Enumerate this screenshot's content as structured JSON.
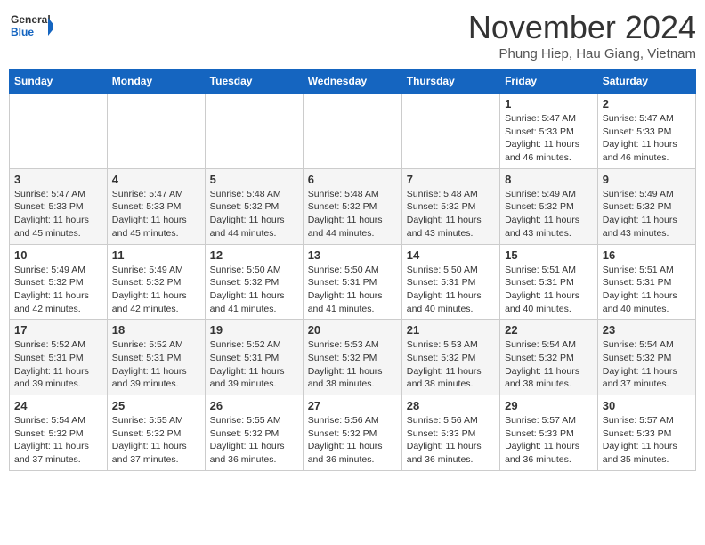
{
  "logo": {
    "general": "General",
    "blue": "Blue"
  },
  "title": "November 2024",
  "location": "Phung Hiep, Hau Giang, Vietnam",
  "headers": [
    "Sunday",
    "Monday",
    "Tuesday",
    "Wednesday",
    "Thursday",
    "Friday",
    "Saturday"
  ],
  "weeks": [
    [
      {
        "day": "",
        "info": ""
      },
      {
        "day": "",
        "info": ""
      },
      {
        "day": "",
        "info": ""
      },
      {
        "day": "",
        "info": ""
      },
      {
        "day": "",
        "info": ""
      },
      {
        "day": "1",
        "info": "Sunrise: 5:47 AM\nSunset: 5:33 PM\nDaylight: 11 hours and 46 minutes."
      },
      {
        "day": "2",
        "info": "Sunrise: 5:47 AM\nSunset: 5:33 PM\nDaylight: 11 hours and 46 minutes."
      }
    ],
    [
      {
        "day": "3",
        "info": "Sunrise: 5:47 AM\nSunset: 5:33 PM\nDaylight: 11 hours and 45 minutes."
      },
      {
        "day": "4",
        "info": "Sunrise: 5:47 AM\nSunset: 5:33 PM\nDaylight: 11 hours and 45 minutes."
      },
      {
        "day": "5",
        "info": "Sunrise: 5:48 AM\nSunset: 5:32 PM\nDaylight: 11 hours and 44 minutes."
      },
      {
        "day": "6",
        "info": "Sunrise: 5:48 AM\nSunset: 5:32 PM\nDaylight: 11 hours and 44 minutes."
      },
      {
        "day": "7",
        "info": "Sunrise: 5:48 AM\nSunset: 5:32 PM\nDaylight: 11 hours and 43 minutes."
      },
      {
        "day": "8",
        "info": "Sunrise: 5:49 AM\nSunset: 5:32 PM\nDaylight: 11 hours and 43 minutes."
      },
      {
        "day": "9",
        "info": "Sunrise: 5:49 AM\nSunset: 5:32 PM\nDaylight: 11 hours and 43 minutes."
      }
    ],
    [
      {
        "day": "10",
        "info": "Sunrise: 5:49 AM\nSunset: 5:32 PM\nDaylight: 11 hours and 42 minutes."
      },
      {
        "day": "11",
        "info": "Sunrise: 5:49 AM\nSunset: 5:32 PM\nDaylight: 11 hours and 42 minutes."
      },
      {
        "day": "12",
        "info": "Sunrise: 5:50 AM\nSunset: 5:32 PM\nDaylight: 11 hours and 41 minutes."
      },
      {
        "day": "13",
        "info": "Sunrise: 5:50 AM\nSunset: 5:31 PM\nDaylight: 11 hours and 41 minutes."
      },
      {
        "day": "14",
        "info": "Sunrise: 5:50 AM\nSunset: 5:31 PM\nDaylight: 11 hours and 40 minutes."
      },
      {
        "day": "15",
        "info": "Sunrise: 5:51 AM\nSunset: 5:31 PM\nDaylight: 11 hours and 40 minutes."
      },
      {
        "day": "16",
        "info": "Sunrise: 5:51 AM\nSunset: 5:31 PM\nDaylight: 11 hours and 40 minutes."
      }
    ],
    [
      {
        "day": "17",
        "info": "Sunrise: 5:52 AM\nSunset: 5:31 PM\nDaylight: 11 hours and 39 minutes."
      },
      {
        "day": "18",
        "info": "Sunrise: 5:52 AM\nSunset: 5:31 PM\nDaylight: 11 hours and 39 minutes."
      },
      {
        "day": "19",
        "info": "Sunrise: 5:52 AM\nSunset: 5:31 PM\nDaylight: 11 hours and 39 minutes."
      },
      {
        "day": "20",
        "info": "Sunrise: 5:53 AM\nSunset: 5:32 PM\nDaylight: 11 hours and 38 minutes."
      },
      {
        "day": "21",
        "info": "Sunrise: 5:53 AM\nSunset: 5:32 PM\nDaylight: 11 hours and 38 minutes."
      },
      {
        "day": "22",
        "info": "Sunrise: 5:54 AM\nSunset: 5:32 PM\nDaylight: 11 hours and 38 minutes."
      },
      {
        "day": "23",
        "info": "Sunrise: 5:54 AM\nSunset: 5:32 PM\nDaylight: 11 hours and 37 minutes."
      }
    ],
    [
      {
        "day": "24",
        "info": "Sunrise: 5:54 AM\nSunset: 5:32 PM\nDaylight: 11 hours and 37 minutes."
      },
      {
        "day": "25",
        "info": "Sunrise: 5:55 AM\nSunset: 5:32 PM\nDaylight: 11 hours and 37 minutes."
      },
      {
        "day": "26",
        "info": "Sunrise: 5:55 AM\nSunset: 5:32 PM\nDaylight: 11 hours and 36 minutes."
      },
      {
        "day": "27",
        "info": "Sunrise: 5:56 AM\nSunset: 5:32 PM\nDaylight: 11 hours and 36 minutes."
      },
      {
        "day": "28",
        "info": "Sunrise: 5:56 AM\nSunset: 5:33 PM\nDaylight: 11 hours and 36 minutes."
      },
      {
        "day": "29",
        "info": "Sunrise: 5:57 AM\nSunset: 5:33 PM\nDaylight: 11 hours and 36 minutes."
      },
      {
        "day": "30",
        "info": "Sunrise: 5:57 AM\nSunset: 5:33 PM\nDaylight: 11 hours and 35 minutes."
      }
    ]
  ]
}
